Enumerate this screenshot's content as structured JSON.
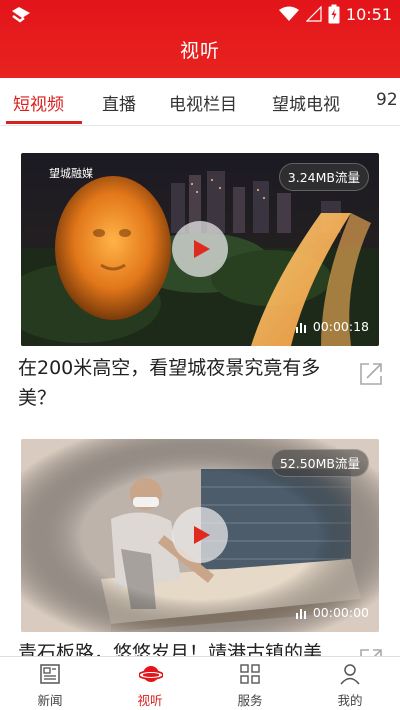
{
  "status_bar": {
    "time": "10:51"
  },
  "header": {
    "title": "视听"
  },
  "tabs": [
    {
      "label": "短视频",
      "active": true
    },
    {
      "label": "直播"
    },
    {
      "label": "电视栏目"
    },
    {
      "label": "望城电视"
    },
    {
      "label": "92"
    }
  ],
  "videos": [
    {
      "title": "在200米高空，看望城夜景究竟有多美？",
      "size": "3.24MB流量",
      "duration": "00:00:18",
      "watermark": "望城融媒"
    },
    {
      "title": "青石板路，悠悠岁月！靖港古镇的美",
      "size": "52.50MB流量",
      "duration": "00:00:00"
    }
  ],
  "bottom_nav": [
    {
      "label": "新闻",
      "icon": "news-icon"
    },
    {
      "label": "视听",
      "icon": "planet-icon",
      "active": true
    },
    {
      "label": "服务",
      "icon": "grid-icon"
    },
    {
      "label": "我的",
      "icon": "user-icon"
    }
  ],
  "colors": {
    "brand": "#e3141a",
    "active": "#d8211f"
  }
}
